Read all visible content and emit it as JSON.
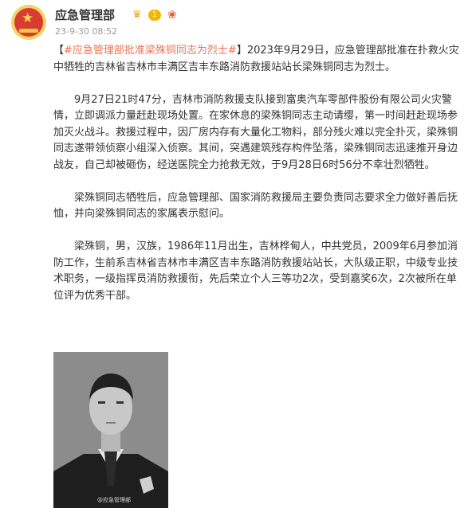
{
  "post": {
    "author": "应急管理部",
    "level_badge": "1",
    "timestamp": "23-9-30 08:52",
    "hashtag": "#应急管理部批准梁殊铜同志为烈士#",
    "lead_open": "【",
    "lead_close": "】2023年9月29日，应急管理部批准在扑救火灾中牺牲的吉林省吉林市丰满区吉丰东路消防救援站站长梁殊铜同志为烈士。",
    "paragraphs": [
      "9月27日21时47分，吉林市消防救援支队接到富奥汽车零部件股份有限公司火灾警情，立即调派力量赶赴现场处置。在家休息的梁殊铜同志主动请缨，第一时间赶赴现场参加灭火战斗。救援过程中，因厂房内存有大量化工物料，部分残火难以完全扑灭，梁殊铜同志遂带领侦察小组深入侦察。其间，突遇建筑残存构件坠落，梁殊铜同志迅速推开身边战友，自己却被砸伤，经送医院全力抢救无效，于9月28日6时56分不幸壮烈牺牲。",
      "梁殊铜同志牺牲后，应急管理部、国家消防救援局主要负责同志要求全力做好善后抚恤，并向梁殊铜同志的家属表示慰问。",
      "梁殊铜，男，汉族，1986年11月出生，吉林桦甸人，中共党员，2009年6月参加消防工作，生前系吉林省吉林市丰满区吉丰东路消防救援站站长，大队级正职，中级专业技术职务，一级指挥员消防救援衔，先后荣立个人三等功2次，受到嘉奖6次，2次被所在单位评为优秀干部。"
    ],
    "photo_watermark": "@应急管理部"
  },
  "colors": {
    "hashtag": "#eb7350",
    "text": "#333333",
    "meta": "#999999"
  },
  "icons": [
    "national-emblem-avatar",
    "crown-icon",
    "level-badge",
    "vip-icon"
  ]
}
